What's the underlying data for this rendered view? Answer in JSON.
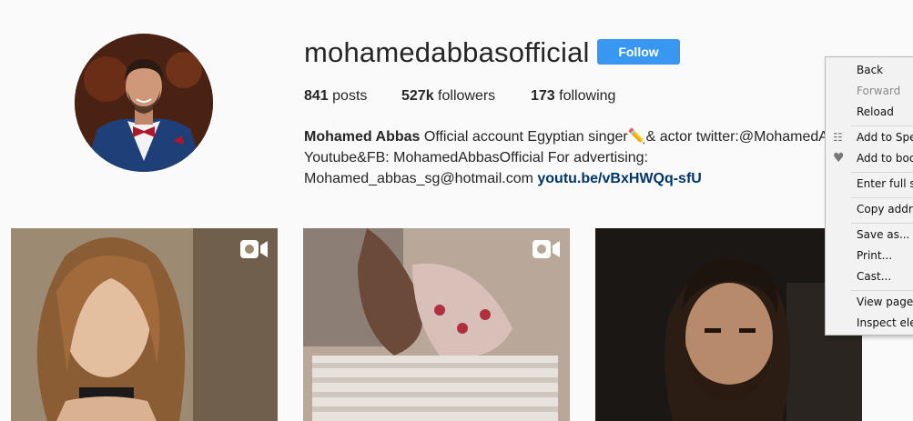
{
  "profile": {
    "username": "mohamedabbasofficial",
    "follow_label": "Follow",
    "stats": [
      {
        "count": "841",
        "label": "posts"
      },
      {
        "count": "527k",
        "label": "followers"
      },
      {
        "count": "173",
        "label": "following"
      }
    ],
    "bio": {
      "full_name": "Mohamed Abbas",
      "line1": " Official account Egyptian singer✏️& actor twitter:@MohamedAbbas",
      "line2": "Youtube&FB: MohamedAbbasOfficial For advertising:",
      "line3": "Mohamed_abbas_sg@hotmail.com ",
      "link": "youtu.be/vBxHWQq-sfU"
    }
  },
  "posts": [
    {
      "type": "video",
      "icon": "video-camera-icon"
    },
    {
      "type": "video",
      "icon": "video-camera-icon"
    },
    {
      "type": "photo",
      "icon": ""
    }
  ],
  "context_menu": {
    "items": [
      {
        "label": "Back",
        "disabled": false
      },
      {
        "label": "Forward",
        "disabled": true
      },
      {
        "label": "Reload",
        "disabled": false
      },
      {
        "label": "Add to Spee",
        "disabled": false,
        "icon": "speed-dial-icon"
      },
      {
        "label": "Add to book",
        "disabled": false,
        "icon": "heart-icon"
      },
      {
        "label": "Enter full scr",
        "disabled": false
      },
      {
        "label": "Copy addres",
        "disabled": false
      },
      {
        "label": "Save as...",
        "disabled": false
      },
      {
        "label": "Print...",
        "disabled": false
      },
      {
        "label": "Cast...",
        "disabled": false
      },
      {
        "label": "View page s",
        "disabled": false
      },
      {
        "label": "Inspect elem",
        "disabled": false
      }
    ]
  },
  "colors": {
    "follow_button": "#3897f0",
    "link": "#003569",
    "background": "#fafafa"
  }
}
